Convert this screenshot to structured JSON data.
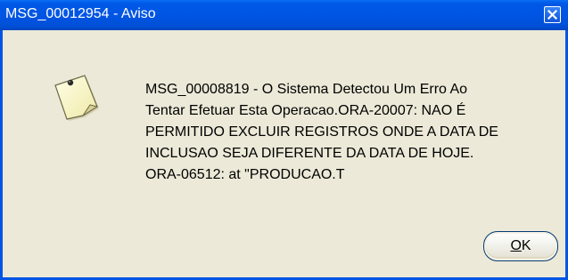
{
  "window": {
    "title": "MSG_00012954 - Aviso",
    "accent_color": "#0055E5",
    "background_color": "#ECE9D8"
  },
  "titlebar": {
    "close_icon": "close-icon"
  },
  "dialog": {
    "icon": "note-icon",
    "message_lines": [
      "MSG_00008819 - O Sistema Detectou Um Erro Ao",
      "Tentar Efetuar Esta Operacao.ORA-20007: NAO É",
      "PERMITIDO EXCLUIR REGISTROS ONDE A DATA DE",
      "INCLUSAO SEJA DIFERENTE DA DATA DE HOJE.",
      "ORA-06512: at \"PRODUCAO.T"
    ],
    "ok_mnemonic": "O",
    "ok_rest": "K"
  }
}
